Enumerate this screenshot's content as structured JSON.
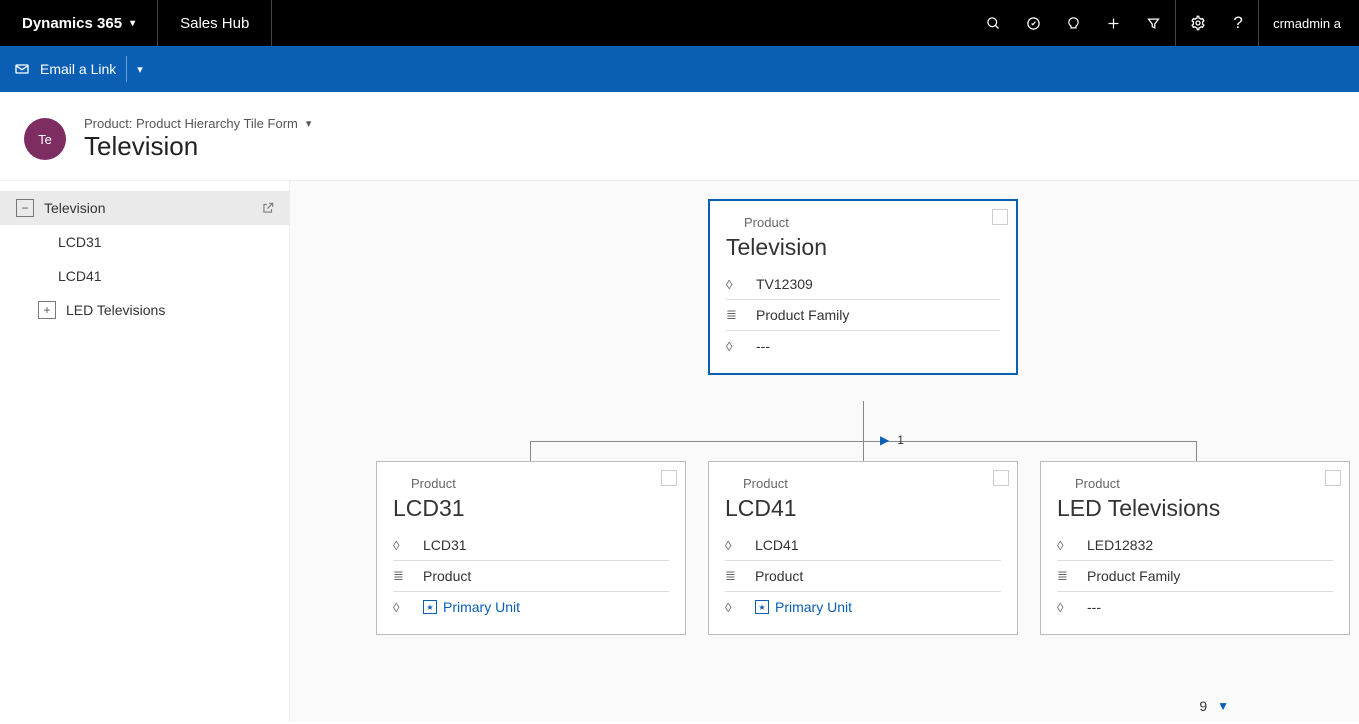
{
  "topbar": {
    "brand": "Dynamics 365",
    "app": "Sales Hub",
    "user": "crmadmin a"
  },
  "cmdbar": {
    "email_link": "Email a Link"
  },
  "header": {
    "avatar_initials": "Te",
    "breadcrumb": "Product: Product Hierarchy Tile Form",
    "title": "Television"
  },
  "tree": {
    "root": "Television",
    "children": [
      "LCD31",
      "LCD41"
    ],
    "branch": "LED Televisions"
  },
  "tiles": {
    "root": {
      "type": "Product",
      "title": "Television",
      "id": "TV12309",
      "structure": "Product Family",
      "unit": "---"
    },
    "c1": {
      "type": "Product",
      "title": "LCD31",
      "id": "LCD31",
      "structure": "Product",
      "unit": "Primary Unit"
    },
    "c2": {
      "type": "Product",
      "title": "LCD41",
      "id": "LCD41",
      "structure": "Product",
      "unit": "Primary Unit"
    },
    "c3": {
      "type": "Product",
      "title": "LED Televisions",
      "id": "LED12832",
      "structure": "Product Family",
      "unit": "---"
    }
  },
  "pager": {
    "page": "1"
  },
  "footer": {
    "count": "9"
  }
}
